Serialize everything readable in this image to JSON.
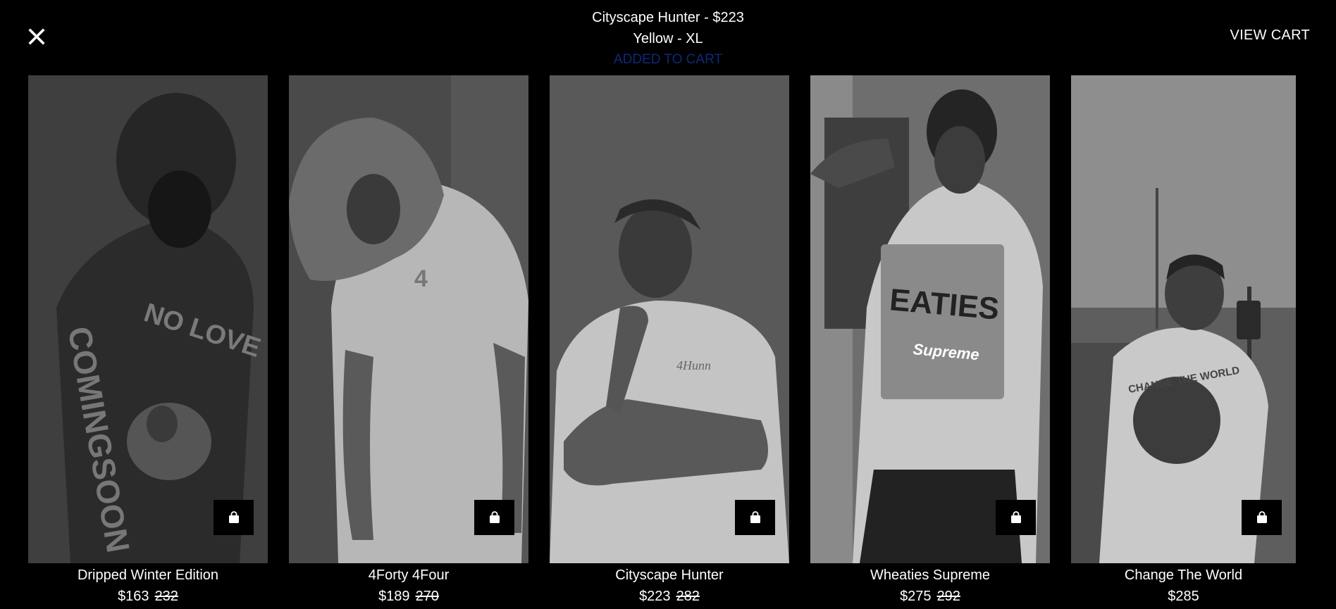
{
  "header": {
    "title_line": "Cityscape Hunter - $223",
    "variant_line": "Yellow - XL",
    "status_line": "ADDED TO CART",
    "view_cart_label": "VIEW CART"
  },
  "icons": {
    "close": "close-icon",
    "bag": "shopping-bag-icon"
  },
  "colors": {
    "background": "#000000",
    "status": "#0c2a7a"
  },
  "products": [
    {
      "name": "Dripped Winter Edition",
      "price": "$163",
      "old_price": "232"
    },
    {
      "name": "4Forty 4Four",
      "price": "$189",
      "old_price": "270"
    },
    {
      "name": "Cityscape Hunter",
      "price": "$223",
      "old_price": "282"
    },
    {
      "name": "Wheaties Supreme",
      "price": "$275",
      "old_price": "292"
    },
    {
      "name": "Change The World",
      "price": "$285",
      "old_price": ""
    }
  ]
}
